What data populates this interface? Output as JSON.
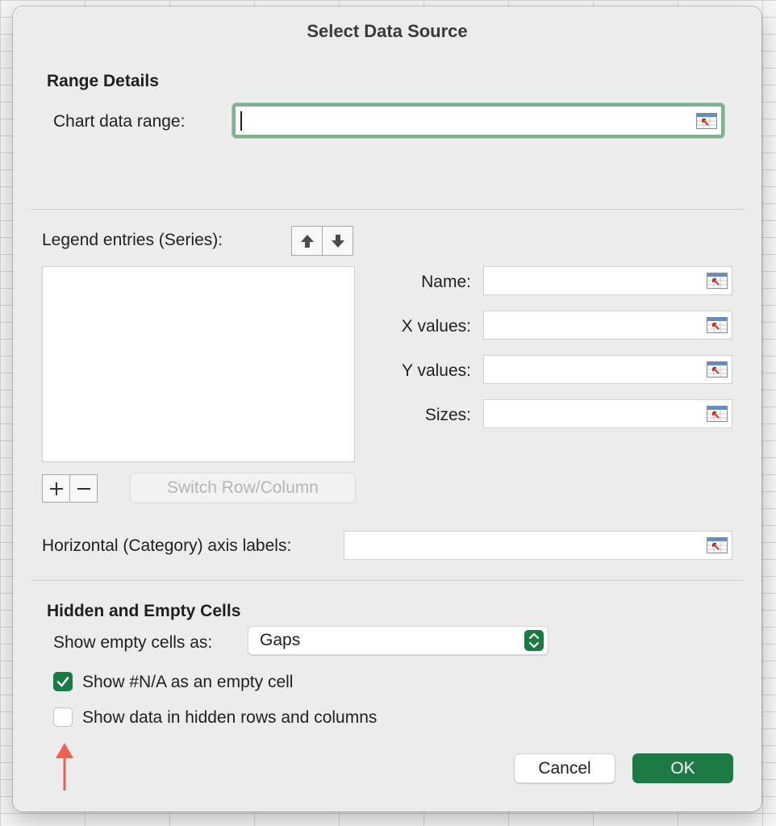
{
  "dialog": {
    "title": "Select Data Source"
  },
  "range_details": {
    "heading": "Range Details",
    "chart_data_range_label": "Chart data range:",
    "chart_data_range_value": ""
  },
  "legend": {
    "label": "Legend entries (Series):",
    "series": [],
    "switch_label": "Switch Row/Column"
  },
  "series_fields": {
    "name_label": "Name:",
    "x_label": "X values:",
    "y_label": "Y values:",
    "sizes_label": "Sizes:"
  },
  "axis": {
    "label": "Horizontal (Category) axis labels:",
    "value": ""
  },
  "hidden_empty": {
    "heading": "Hidden and Empty Cells",
    "show_empty_label": "Show empty cells as:",
    "show_empty_value": "Gaps",
    "na_label": "Show #N/A as an empty cell",
    "na_checked": true,
    "hidden_label": "Show data in hidden rows and columns",
    "hidden_checked": false
  },
  "buttons": {
    "cancel": "Cancel",
    "ok": "OK"
  },
  "colors": {
    "accent": "#1d7a45",
    "focus_ring": "#7db28e",
    "annotation_arrow": "#f0614f"
  }
}
